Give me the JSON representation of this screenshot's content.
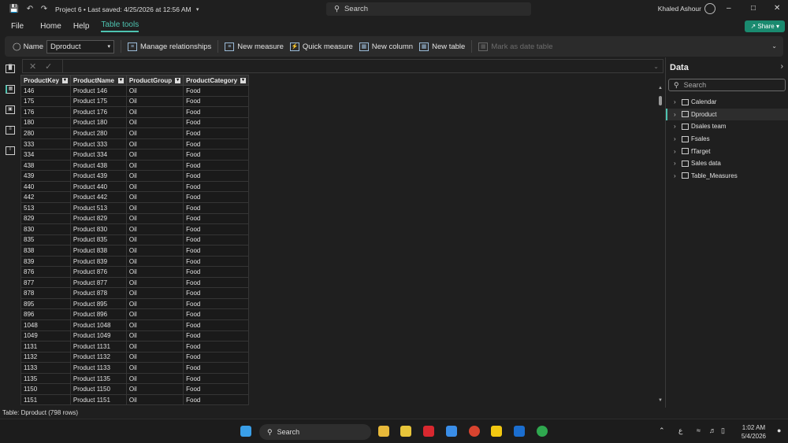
{
  "titlebar": {
    "title": "Project 6 • Last saved: 4/25/2026 at 12:56 AM",
    "search_placeholder": "Search",
    "user_name": "Khaled Ashour"
  },
  "menu": {
    "file": "File",
    "home": "Home",
    "help": "Help",
    "table_tools": "Table tools",
    "share": "Share"
  },
  "ribbon": {
    "name_label": "Name",
    "name_value": "Dproduct",
    "manage_relationships": "Manage relationships",
    "new_measure": "New measure",
    "quick_measure": "Quick measure",
    "new_column": "New column",
    "new_table": "New table",
    "mark_as_date_table": "Mark as date table"
  },
  "table": {
    "columns": [
      "ProductKey",
      "ProductName",
      "ProductGroup",
      "ProductCategory"
    ],
    "rows": [
      [
        "146",
        "Product 146",
        "Oil",
        "Food"
      ],
      [
        "175",
        "Product 175",
        "Oil",
        "Food"
      ],
      [
        "176",
        "Product 176",
        "Oil",
        "Food"
      ],
      [
        "180",
        "Product 180",
        "Oil",
        "Food"
      ],
      [
        "280",
        "Product 280",
        "Oil",
        "Food"
      ],
      [
        "333",
        "Product 333",
        "Oil",
        "Food"
      ],
      [
        "334",
        "Product 334",
        "Oil",
        "Food"
      ],
      [
        "438",
        "Product 438",
        "Oil",
        "Food"
      ],
      [
        "439",
        "Product 439",
        "Oil",
        "Food"
      ],
      [
        "440",
        "Product 440",
        "Oil",
        "Food"
      ],
      [
        "442",
        "Product 442",
        "Oil",
        "Food"
      ],
      [
        "513",
        "Product 513",
        "Oil",
        "Food"
      ],
      [
        "829",
        "Product 829",
        "Oil",
        "Food"
      ],
      [
        "830",
        "Product 830",
        "Oil",
        "Food"
      ],
      [
        "835",
        "Product 835",
        "Oil",
        "Food"
      ],
      [
        "838",
        "Product 838",
        "Oil",
        "Food"
      ],
      [
        "839",
        "Product 839",
        "Oil",
        "Food"
      ],
      [
        "876",
        "Product 876",
        "Oil",
        "Food"
      ],
      [
        "877",
        "Product 877",
        "Oil",
        "Food"
      ],
      [
        "878",
        "Product 878",
        "Oil",
        "Food"
      ],
      [
        "895",
        "Product 895",
        "Oil",
        "Food"
      ],
      [
        "896",
        "Product 896",
        "Oil",
        "Food"
      ],
      [
        "1048",
        "Product 1048",
        "Oil",
        "Food"
      ],
      [
        "1049",
        "Product 1049",
        "Oil",
        "Food"
      ],
      [
        "1131",
        "Product 1131",
        "Oil",
        "Food"
      ],
      [
        "1132",
        "Product 1132",
        "Oil",
        "Food"
      ],
      [
        "1133",
        "Product 1133",
        "Oil",
        "Food"
      ],
      [
        "1135",
        "Product 1135",
        "Oil",
        "Food"
      ],
      [
        "1150",
        "Product 1150",
        "Oil",
        "Food"
      ],
      [
        "1151",
        "Product 1151",
        "Oil",
        "Food"
      ]
    ]
  },
  "data_pane": {
    "title": "Data",
    "search_placeholder": "Search",
    "tables": [
      "Calendar",
      "Dproduct",
      "Dsales team",
      "Fsales",
      "fTarget",
      "Sales data",
      "Table_Measures"
    ],
    "selected": "Dproduct"
  },
  "status_bar": {
    "text": "Table: Dproduct (798 rows)"
  },
  "taskbar": {
    "search_label": "Search",
    "time": "1:02 AM",
    "date": "5/4/2026",
    "lang": "ع"
  },
  "colors": {
    "accent": "#4ec3b0",
    "share_button": "#1a8a6f",
    "background": "#1f1f1f"
  }
}
